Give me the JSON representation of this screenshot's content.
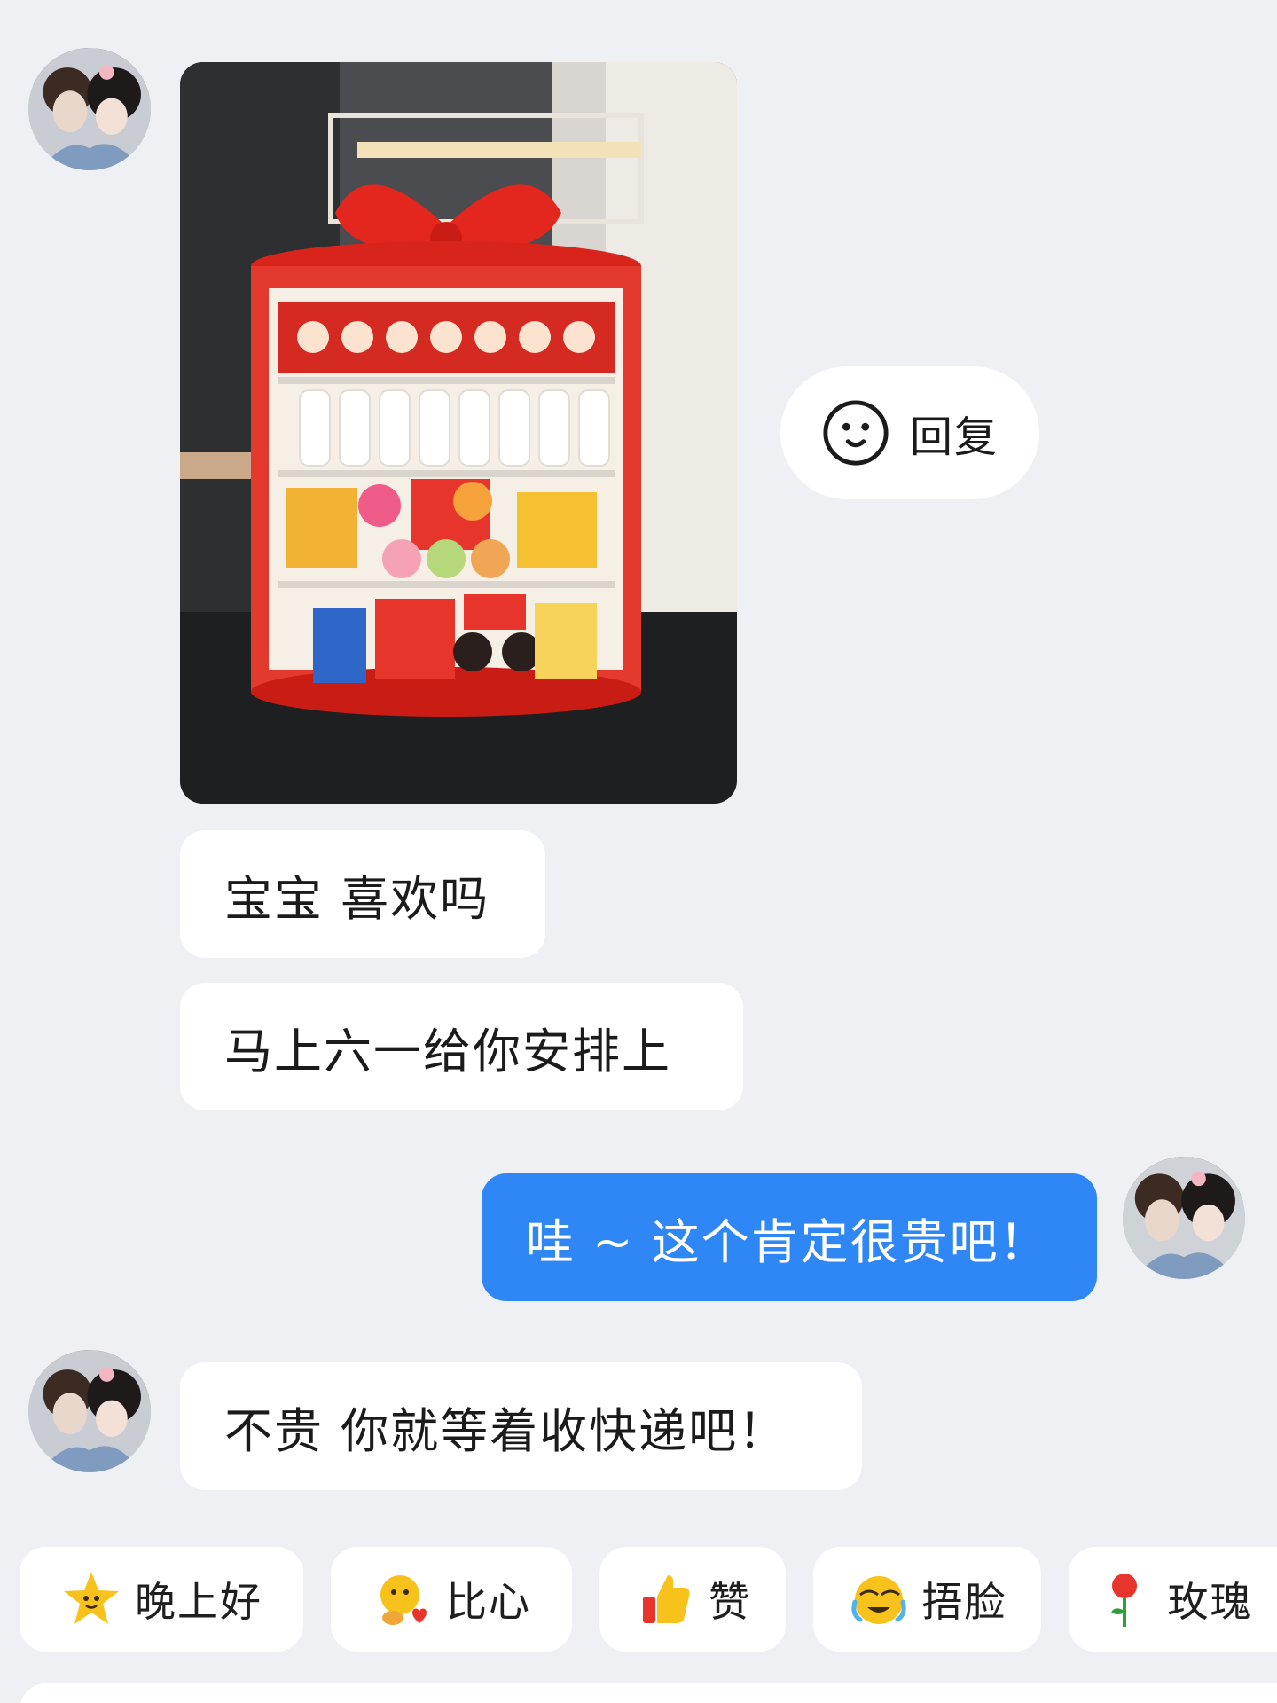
{
  "messages": [
    {
      "direction": "incoming",
      "type": "image",
      "description_icon": "gift-cake-snack-photo"
    },
    {
      "direction": "incoming",
      "type": "text",
      "text": "宝宝 喜欢吗"
    },
    {
      "direction": "incoming",
      "type": "text",
      "text": "马上六一给你安排上"
    },
    {
      "direction": "outgoing",
      "type": "text",
      "text": "哇 ~ 这个肯定很贵吧！"
    },
    {
      "direction": "incoming",
      "type": "text",
      "text": "不贵 你就等着收快递吧！"
    }
  ],
  "reply_action": {
    "label": "回复",
    "icon": "smiley-icon"
  },
  "quick_replies": [
    {
      "label": "晚上好",
      "icon": "star-face-icon"
    },
    {
      "label": "比心",
      "icon": "heart-hands-icon"
    },
    {
      "label": "赞",
      "icon": "thumbs-up-icon"
    },
    {
      "label": "捂脸",
      "icon": "facepalm-icon"
    },
    {
      "label": "玫瑰",
      "icon": "rose-icon"
    }
  ],
  "colors": {
    "background": "#eef0f3",
    "incoming_bubble": "#ffffff",
    "outgoing_bubble": "#2f87f5"
  }
}
